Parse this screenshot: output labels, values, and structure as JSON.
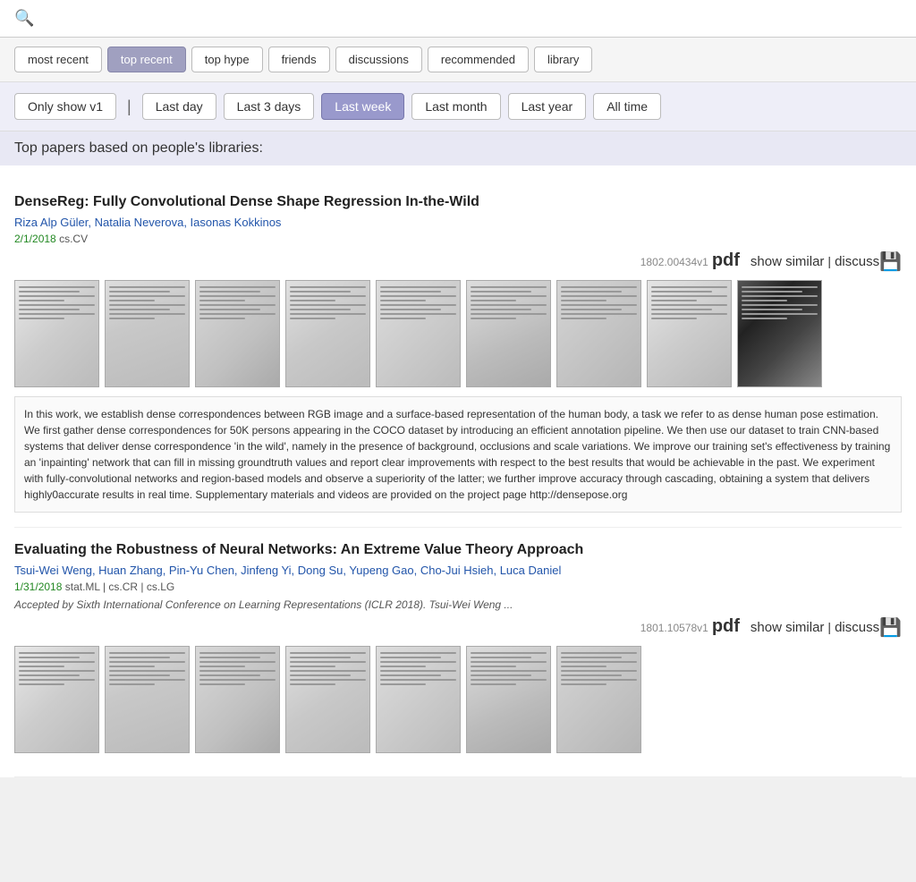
{
  "search": {
    "placeholder": ""
  },
  "tabs": [
    {
      "id": "most-recent",
      "label": "most recent",
      "active": false
    },
    {
      "id": "top-recent",
      "label": "top recent",
      "active": true
    },
    {
      "id": "top-hype",
      "label": "top hype",
      "active": false
    },
    {
      "id": "friends",
      "label": "friends",
      "active": false
    },
    {
      "id": "discussions",
      "label": "discussions",
      "active": false
    },
    {
      "id": "recommended",
      "label": "recommended",
      "active": false
    },
    {
      "id": "library",
      "label": "library",
      "active": false
    }
  ],
  "filters": [
    {
      "id": "only-show-v1",
      "label": "Only show v1",
      "active": false
    },
    {
      "id": "separator",
      "label": "|"
    },
    {
      "id": "last-day",
      "label": "Last day",
      "active": false
    },
    {
      "id": "last-3-days",
      "label": "Last 3 days",
      "active": false
    },
    {
      "id": "last-week",
      "label": "Last week",
      "active": true
    },
    {
      "id": "last-month",
      "label": "Last month",
      "active": false
    },
    {
      "id": "last-year",
      "label": "Last year",
      "active": false
    },
    {
      "id": "all-time",
      "label": "All time",
      "active": false
    }
  ],
  "section_header": "Top papers based on people's libraries:",
  "papers": [
    {
      "id": "paper1",
      "title": "DenseReg: Fully Convolutional Dense Shape Regression In-the-Wild",
      "authors": "Riza Alp Güler, Natalia Neverova, Iasonas Kokkinos",
      "date": "2/1/2018",
      "categories": "cs.CV",
      "version": "1802.00434v1",
      "accepted": "",
      "abstract": "In this work, we establish dense correspondences between RGB image and a surface-based representation of the human body, a task we refer to as dense human pose estimation. We first gather dense correspondences for 50K persons appearing in the COCO dataset by introducing an efficient annotation pipeline. We then use our dataset to train CNN-based systems that deliver dense correspondence 'in the wild', namely in the presence of background, occlusions and scale variations. We improve our training set's effectiveness by training an 'inpainting' network that can fill in missing groundtruth values and report clear improvements with respect to the best results that would be achievable in the past. We experiment with fully-convolutional networks and region-based models and observe a superiority of the latter; we further improve accuracy through cascading, obtaining a system that delivers highly0accurate results in real time. Supplementary materials and videos are provided on the project page http://densepose.org"
    },
    {
      "id": "paper2",
      "title": "Evaluating the Robustness of Neural Networks: An Extreme Value Theory Approach",
      "authors": "Tsui-Wei Weng, Huan Zhang, Pin-Yu Chen, Jinfeng Yi, Dong Su, Yupeng Gao, Cho-Jui Hsieh, Luca Daniel",
      "date": "1/31/2018",
      "categories": "stat.ML | cs.CR | cs.LG",
      "version": "1801.10578v1",
      "accepted": "Accepted by Sixth International Conference on Learning Representations (ICLR 2018). Tsui-Wei Weng ...",
      "abstract": ""
    }
  ]
}
